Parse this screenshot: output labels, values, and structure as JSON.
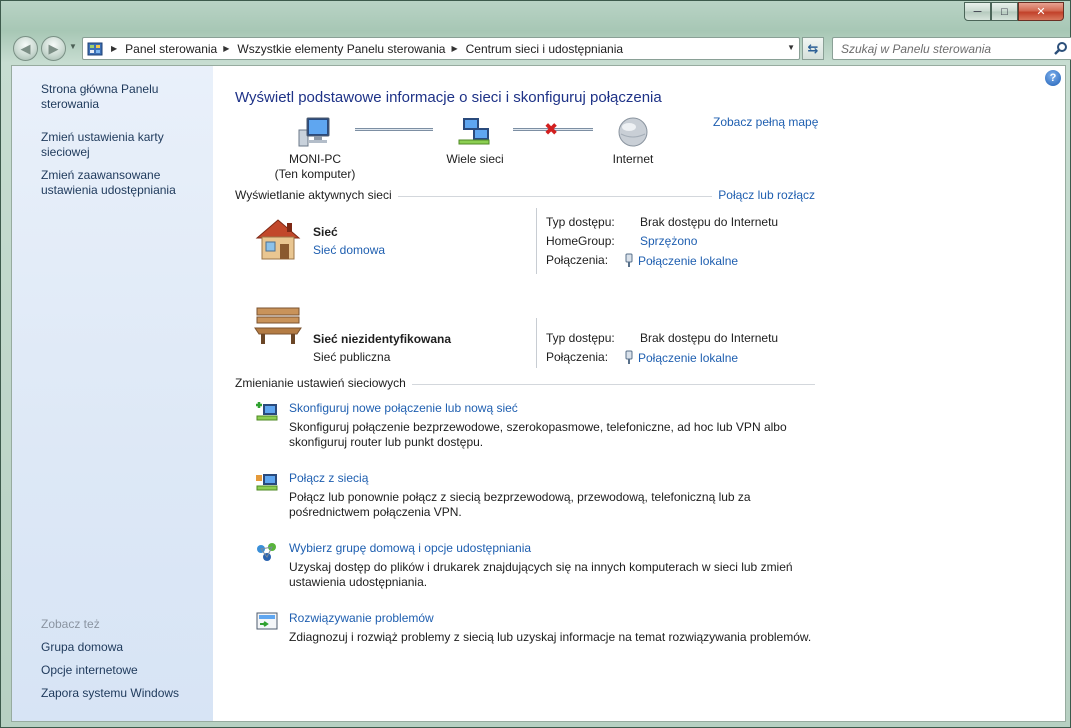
{
  "window": {
    "caption_buttons": {
      "minimize": "─",
      "maximize": "□",
      "close": "✕"
    }
  },
  "address_bar": {
    "breadcrumbs": [
      "Panel sterowania",
      "Wszystkie elementy Panelu sterowania",
      "Centrum sieci i udostępniania"
    ],
    "search_placeholder": "Szukaj w Panelu sterowania"
  },
  "sidebar": {
    "links": [
      "Strona główna Panelu sterowania",
      "Zmień ustawienia karty sieciowej",
      "Zmień zaawansowane ustawienia udostępniania"
    ],
    "see_also_title": "Zobacz też",
    "see_also_links": [
      "Grupa domowa",
      "Opcje internetowe",
      "Zapora systemu Windows"
    ]
  },
  "main": {
    "title": "Wyświetl podstawowe informacje o sieci i skonfiguruj połączenia",
    "full_map_link": "Zobacz pełną mapę",
    "map": {
      "computer_name": "MONI-PC",
      "computer_sub": "(Ten komputer)",
      "middle_label": "Wiele sieci",
      "internet_label": "Internet"
    },
    "active_networks_header": "Wyświetlanie aktywnych sieci",
    "connect_disconnect_link": "Połącz lub rozłącz",
    "networks": [
      {
        "name": "Sieć",
        "type": "Sieć domowa",
        "props": [
          {
            "label": "Typ dostępu:",
            "value": "Brak dostępu do Internetu"
          },
          {
            "label": "HomeGroup:",
            "value": "Sprzężono"
          },
          {
            "label": "Połączenia:",
            "value": "Połączenie lokalne"
          }
        ]
      },
      {
        "name": "Sieć niezidentyfikowana",
        "type": "Sieć publiczna",
        "props": [
          {
            "label": "Typ dostępu:",
            "value": "Brak dostępu do Internetu"
          },
          {
            "label": "Połączenia:",
            "value": "Połączenie lokalne"
          }
        ]
      }
    ],
    "change_settings_header": "Zmienianie ustawień sieciowych",
    "tasks": [
      {
        "link": "Skonfiguruj nowe połączenie lub nową sieć",
        "desc": "Skonfiguruj połączenie bezprzewodowe, szerokopasmowe, telefoniczne, ad hoc lub VPN albo skonfiguruj router lub punkt dostępu."
      },
      {
        "link": "Połącz z siecią",
        "desc": "Połącz lub ponownie połącz z siecią bezprzewodową, przewodową, telefoniczną lub za pośrednictwem połączenia VPN."
      },
      {
        "link": "Wybierz grupę domową i opcje udostępniania",
        "desc": "Uzyskaj dostęp do plików i drukarek znajdujących się na innych komputerach w sieci lub zmień ustawienia udostępniania."
      },
      {
        "link": "Rozwiązywanie problemów",
        "desc": "Zdiagnozuj i rozwiąż problemy z siecią lub uzyskaj informacje na temat rozwiązywania problemów."
      }
    ]
  }
}
